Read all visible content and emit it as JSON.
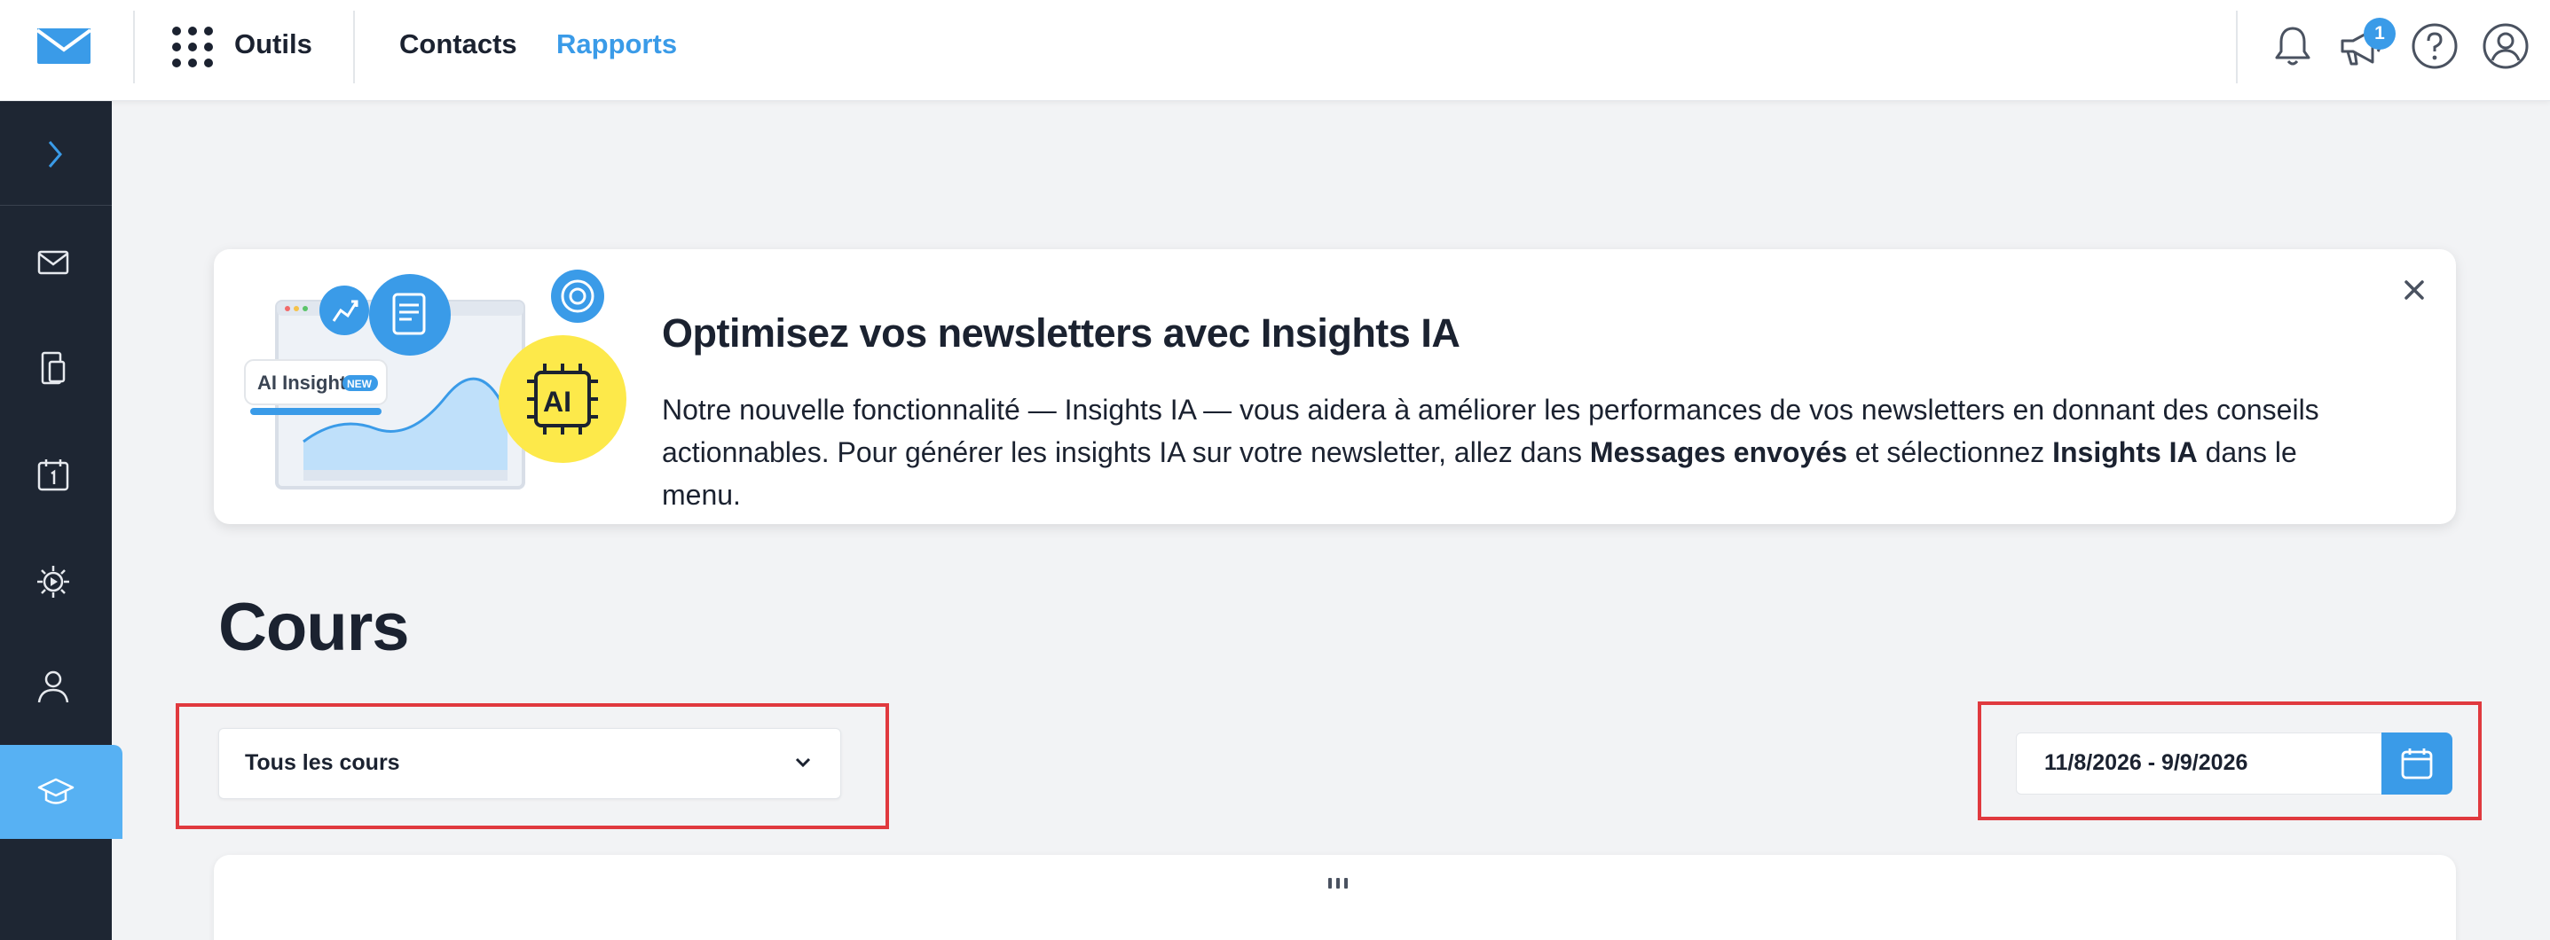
{
  "topbar": {
    "tools_label": "Outils",
    "nav": [
      {
        "label": "Contacts"
      },
      {
        "label": "Rapports"
      }
    ],
    "notification_badge": "1"
  },
  "banner": {
    "title": "Optimisez vos newsletters avec Insights IA",
    "text_part1": "Notre nouvelle fonctionnalité — Insights IA — vous aidera à améliorer les performances de vos newsletters en donnant des conseils actionnables. Pour générer les insights IA sur votre newsletter, allez dans ",
    "text_bold1": "Messages envoyés",
    "text_part2": " et sélectionnez ",
    "text_bold2": "Insights IA",
    "text_part3": " dans le menu.",
    "illustration_label": "AI Insights",
    "illustration_badge": "NEW",
    "illustration_chip": "AI"
  },
  "page": {
    "title": "Cours",
    "course_select": "Tous les cours",
    "date_range": "11/8/2026 - 9/9/2026"
  },
  "colors": {
    "accent": "#3a9be8",
    "sidebar": "#1e2633",
    "sidebar_active": "#57b1f3",
    "highlight_box": "#e0393e"
  },
  "icons": {
    "logo": "envelope-logo-icon",
    "apps": "grid-dots-icon",
    "bell": "bell-icon",
    "announce": "megaphone-icon",
    "help": "help-circle-icon",
    "account": "user-circle-icon",
    "close": "close-icon",
    "dropdown": "chevron-down-icon",
    "calendar": "calendar-icon"
  }
}
